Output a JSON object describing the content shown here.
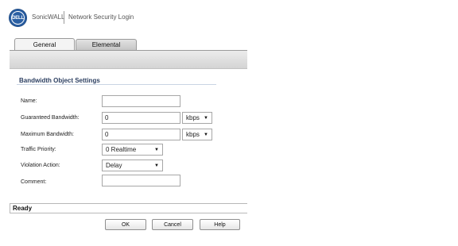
{
  "header": {
    "logo_text": "DELL",
    "product": "SonicWALL",
    "subtitle": "Network Security Login"
  },
  "tabs": [
    {
      "label": "General",
      "active": true
    },
    {
      "label": "Elemental",
      "active": false
    }
  ],
  "section": {
    "title": "Bandwidth Object Settings"
  },
  "form": {
    "name": {
      "label": "Name:",
      "value": ""
    },
    "guaranteed": {
      "label": "Guaranteed Bandwidth:",
      "value": "0",
      "unit": "kbps"
    },
    "maximum": {
      "label": "Maximum Bandwidth:",
      "value": "0",
      "unit": "kbps"
    },
    "priority": {
      "label": "Traffic Priority:",
      "value": "0 Realtime"
    },
    "violation": {
      "label": "Violation Action:",
      "value": "Delay"
    },
    "comment": {
      "label": "Comment:",
      "value": ""
    }
  },
  "status": {
    "text": "Ready"
  },
  "buttons": {
    "ok": "OK",
    "cancel": "Cancel",
    "help": "Help"
  },
  "colors": {
    "section_title": "#2c3f61",
    "logo": "#2a5fa3"
  }
}
